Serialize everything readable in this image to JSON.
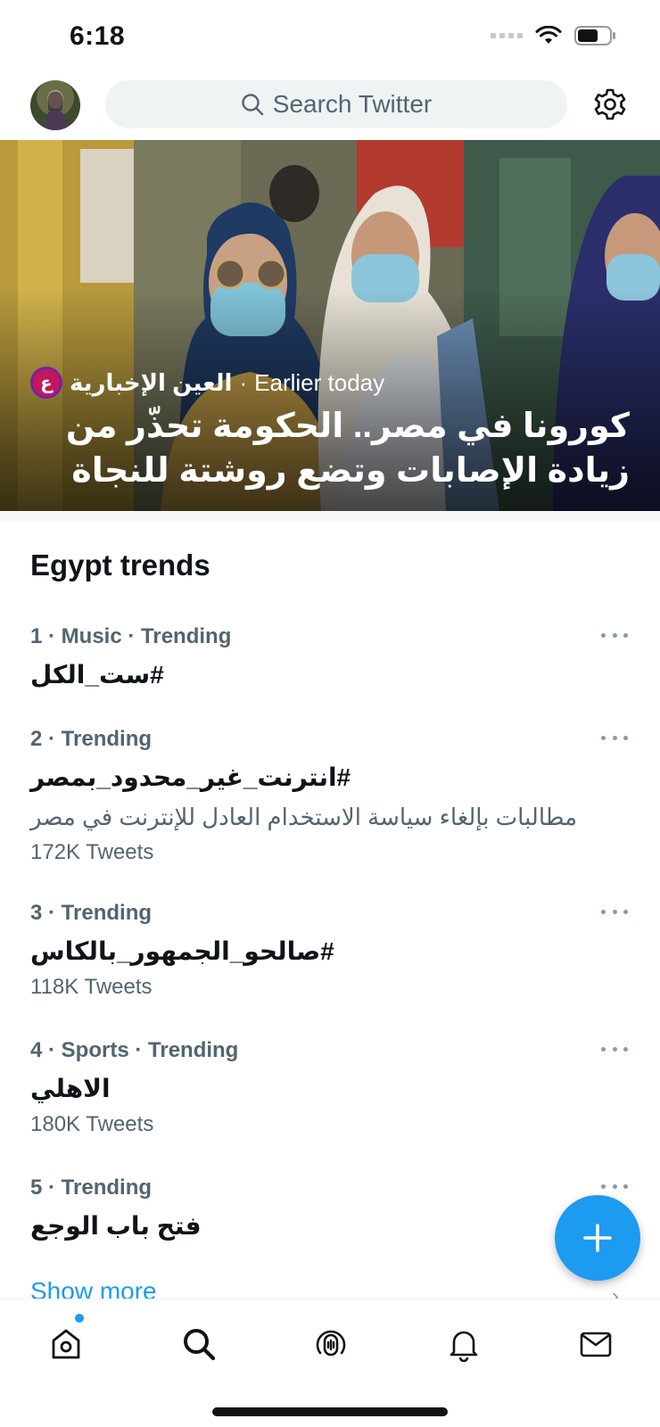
{
  "status_bar": {
    "time": "6:18"
  },
  "top_nav": {
    "search_placeholder": "Search Twitter"
  },
  "hero": {
    "source_logo_letter": "ع",
    "source_name": "العين الإخبارية",
    "separator": "·",
    "timestamp": "Earlier today",
    "title": "كورونا في مصر.. الحكومة تحذّر من زيادة الإصابات وتضع روشتة للنجاة"
  },
  "trends": {
    "heading": "Egypt trends",
    "items": [
      {
        "meta": "1 · Music · Trending",
        "name": "#ست_الكل",
        "description": "",
        "count": ""
      },
      {
        "meta": "2 · Trending",
        "name": "#انترنت_غير_محدود_بمصر",
        "description": "مطالبات بإلغاء سياسة الاستخدام العادل للإنترنت في مصر",
        "count": "172K Tweets"
      },
      {
        "meta": "3 · Trending",
        "name": "#صالحو_الجمهور_بالكاس",
        "description": "",
        "count": "118K Tweets"
      },
      {
        "meta": "4 · Sports · Trending",
        "name": "الاهلي",
        "description": "",
        "count": "180K Tweets"
      },
      {
        "meta": "5 · Trending",
        "name": "فتح باب الوجع",
        "description": "",
        "count": ""
      }
    ],
    "show_more": "Show more"
  },
  "bottom_nav": {
    "items": [
      "home-icon",
      "search-icon",
      "spaces-icon",
      "notifications-icon",
      "messages-icon"
    ]
  },
  "colors": {
    "accent": "#1d9bf0",
    "text_primary": "#0f1419",
    "text_secondary": "#536471"
  }
}
